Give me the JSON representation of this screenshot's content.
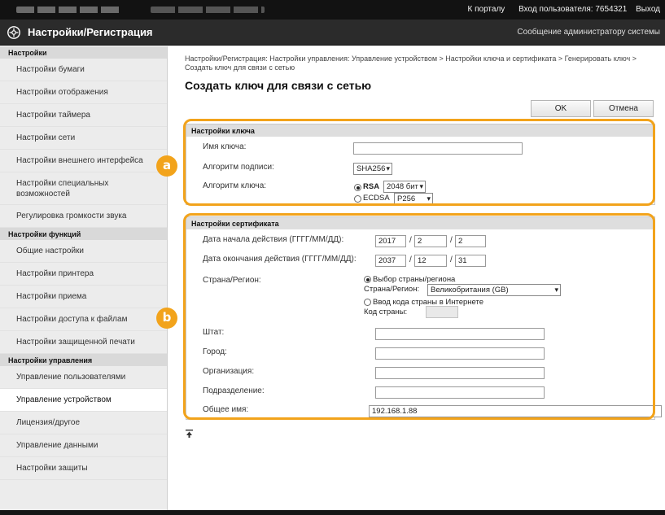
{
  "topbar": {
    "portal_link": "К порталу",
    "login_user": "Вход пользователя:  7654321",
    "logout": "Выход"
  },
  "titlebar": {
    "title": "Настройки/Регистрация",
    "admin_message": "Сообщение администратору системы"
  },
  "sidebar": {
    "section1": "Настройки",
    "items1": [
      "Настройки бумаги",
      "Настройки отображения",
      "Настройки таймера",
      "Настройки сети",
      "Настройки внешнего интерфейса",
      "Настройки специальных возможностей",
      "Регулировка громкости звука"
    ],
    "section2": "Настройки функций",
    "items2": [
      "Общие настройки",
      "Настройки принтера",
      "Настройки приема",
      "Настройки доступа к файлам",
      "Настройки защищенной печати"
    ],
    "section3": "Настройки управления",
    "items3": [
      "Управление пользователями",
      "Управление устройством",
      "Лицензия/другое",
      "Управление данными",
      "Настройки защиты"
    ]
  },
  "main": {
    "breadcrumb": "Настройки/Регистрация: Настройки управления: Управление устройством > Настройки ключа и сертификата > Генерировать ключ > Создать ключ для связи с сетью",
    "title": "Создать ключ для связи с сетью",
    "ok_label": "OK",
    "cancel_label": "Отмена"
  },
  "key_settings": {
    "header": "Настройки ключа",
    "key_name_label": "Имя ключа:",
    "key_name_value": "",
    "sig_algo_label": "Алгоритм подписи:",
    "sig_algo_value": "SHA256",
    "key_algo_label": "Алгоритм ключа:",
    "rsa_label": "RSA",
    "rsa_value": "2048 бит",
    "ecdsa_label": "ECDSA",
    "ecdsa_value": "P256"
  },
  "cert_settings": {
    "header": "Настройки сертификата",
    "start_label": "Дата начала действия (ГГГГ/ММ/ДД):",
    "start_year": "2017",
    "start_month": "2",
    "start_day": "2",
    "end_label": "Дата окончания действия (ГГГГ/ММ/ДД):",
    "end_year": "2037",
    "end_month": "12",
    "end_day": "31",
    "country_label": "Страна/Регион:",
    "choose_country_label": "Выбор страны/региона",
    "country_sel_label": "Страна/Регион:",
    "country_value": "Великобритания (GB)",
    "internet_code_label": "Ввод кода страны в Интернете",
    "country_code_label": "Код страны:",
    "state_label": "Штат:",
    "city_label": "Город:",
    "org_label": "Организация:",
    "unit_label": "Подразделение:",
    "common_name_label": "Общее имя:",
    "common_name_value": "192.168.1.88"
  },
  "callouts": [
    "a",
    "b"
  ],
  "colors": {
    "accent": "#f2a31b",
    "topbar": "#121212",
    "titlebar": "#2b2b2b"
  }
}
